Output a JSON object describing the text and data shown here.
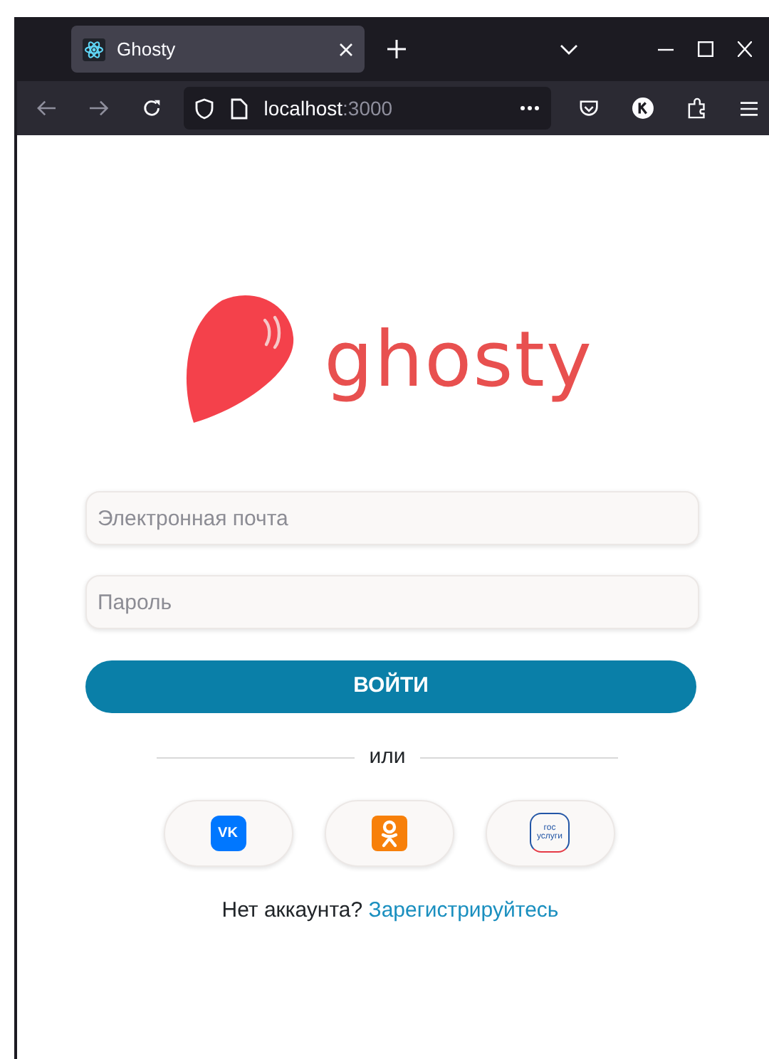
{
  "browser": {
    "tab_title": "Ghosty",
    "url_host": "localhost",
    "url_port": ":3000"
  },
  "logo": {
    "text": "ghosty"
  },
  "form": {
    "fields": [
      {
        "placeholder": "Электронная почта"
      },
      {
        "placeholder": "Пароль"
      }
    ],
    "submit": "ВОЙТИ",
    "divider": "или"
  },
  "social": [
    {
      "kind": "vk",
      "label": "VK"
    },
    {
      "kind": "ok"
    },
    {
      "kind": "gos",
      "label": "гос услуги"
    }
  ],
  "footer": {
    "text": "Нет аккаунта?",
    "link": "Зарегистрируйтесь"
  }
}
